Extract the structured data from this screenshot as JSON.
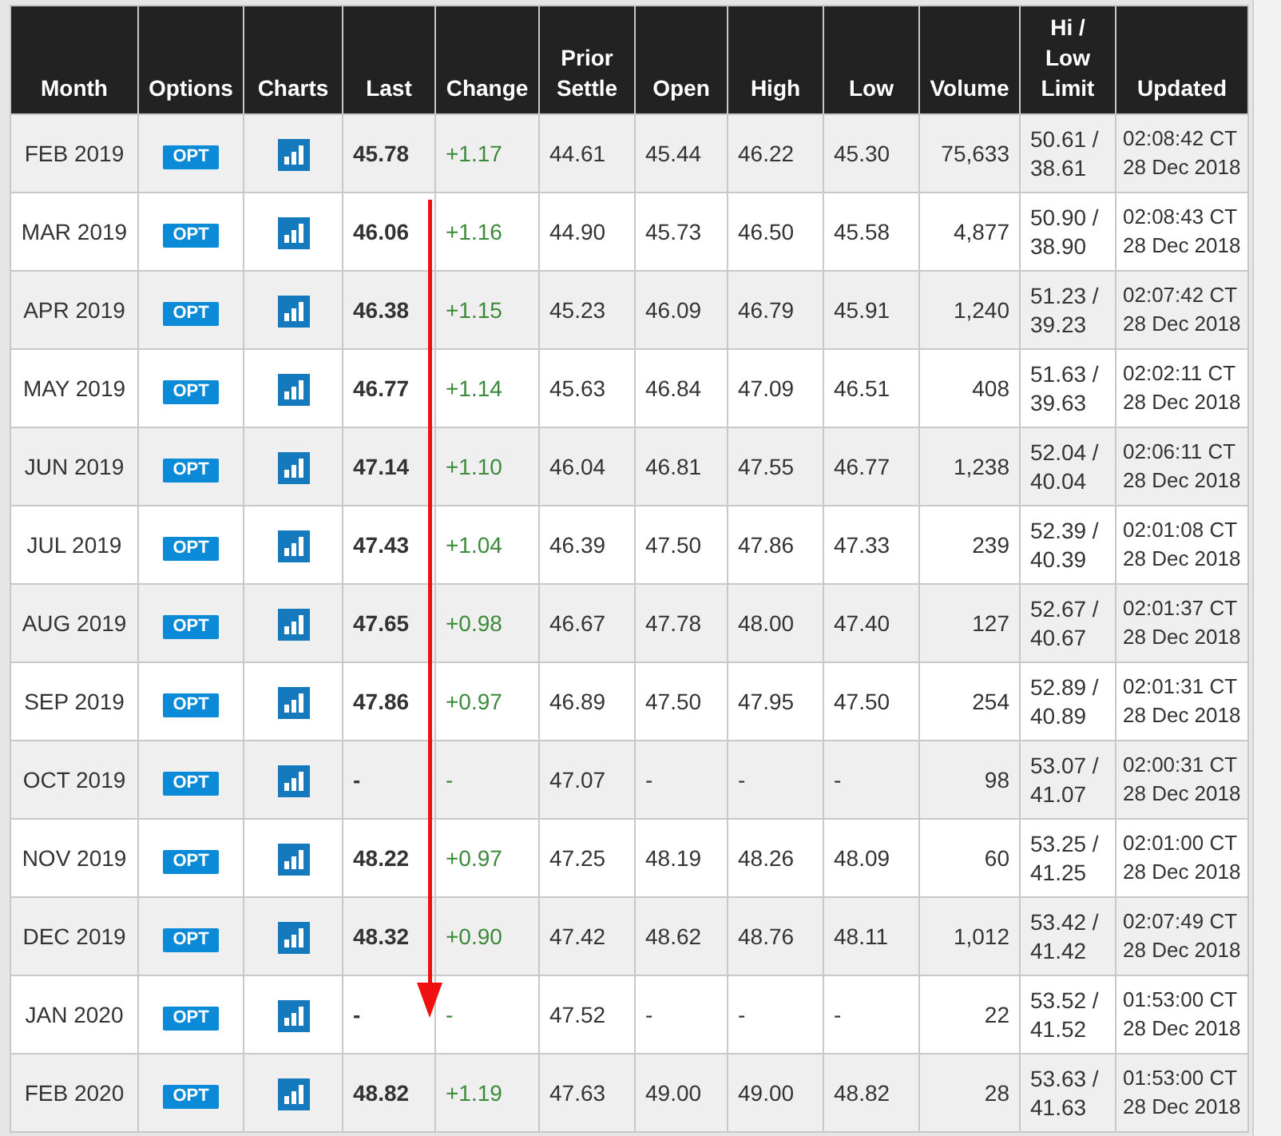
{
  "columns": [
    [
      "Month"
    ],
    [
      "Options"
    ],
    [
      "Charts"
    ],
    [
      "Last"
    ],
    [
      "Change"
    ],
    [
      "Prior",
      "Settle"
    ],
    [
      "Open"
    ],
    [
      "High"
    ],
    [
      "Low"
    ],
    [
      "Volume"
    ],
    [
      "Hi /",
      "Low",
      "Limit"
    ],
    [
      "Updated"
    ]
  ],
  "rows": [
    {
      "month": "FEB 2019",
      "options": "OPT",
      "last": "45.78",
      "change": "+1.17",
      "prior_settle": "44.61",
      "open": "45.44",
      "high": "46.22",
      "low": "45.30",
      "volume": "75,633",
      "limit_hi": "50.61 /",
      "limit_low": "38.61",
      "updated_time": "02:08:42 CT",
      "updated_date": "28 Dec 2018"
    },
    {
      "month": "MAR 2019",
      "options": "OPT",
      "last": "46.06",
      "change": "+1.16",
      "prior_settle": "44.90",
      "open": "45.73",
      "high": "46.50",
      "low": "45.58",
      "volume": "4,877",
      "limit_hi": "50.90 /",
      "limit_low": "38.90",
      "updated_time": "02:08:43 CT",
      "updated_date": "28 Dec 2018"
    },
    {
      "month": "APR 2019",
      "options": "OPT",
      "last": "46.38",
      "change": "+1.15",
      "prior_settle": "45.23",
      "open": "46.09",
      "high": "46.79",
      "low": "45.91",
      "volume": "1,240",
      "limit_hi": "51.23 /",
      "limit_low": "39.23",
      "updated_time": "02:07:42 CT",
      "updated_date": "28 Dec 2018"
    },
    {
      "month": "MAY 2019",
      "options": "OPT",
      "last": "46.77",
      "change": "+1.14",
      "prior_settle": "45.63",
      "open": "46.84",
      "high": "47.09",
      "low": "46.51",
      "volume": "408",
      "limit_hi": "51.63 /",
      "limit_low": "39.63",
      "updated_time": "02:02:11 CT",
      "updated_date": "28 Dec 2018"
    },
    {
      "month": "JUN 2019",
      "options": "OPT",
      "last": "47.14",
      "change": "+1.10",
      "prior_settle": "46.04",
      "open": "46.81",
      "high": "47.55",
      "low": "46.77",
      "volume": "1,238",
      "limit_hi": "52.04 /",
      "limit_low": "40.04",
      "updated_time": "02:06:11 CT",
      "updated_date": "28 Dec 2018"
    },
    {
      "month": "JUL 2019",
      "options": "OPT",
      "last": "47.43",
      "change": "+1.04",
      "prior_settle": "46.39",
      "open": "47.50",
      "high": "47.86",
      "low": "47.33",
      "volume": "239",
      "limit_hi": "52.39 /",
      "limit_low": "40.39",
      "updated_time": "02:01:08 CT",
      "updated_date": "28 Dec 2018"
    },
    {
      "month": "AUG 2019",
      "options": "OPT",
      "last": "47.65",
      "change": "+0.98",
      "prior_settle": "46.67",
      "open": "47.78",
      "high": "48.00",
      "low": "47.40",
      "volume": "127",
      "limit_hi": "52.67 /",
      "limit_low": "40.67",
      "updated_time": "02:01:37 CT",
      "updated_date": "28 Dec 2018"
    },
    {
      "month": "SEP 2019",
      "options": "OPT",
      "last": "47.86",
      "change": "+0.97",
      "prior_settle": "46.89",
      "open": "47.50",
      "high": "47.95",
      "low": "47.50",
      "volume": "254",
      "limit_hi": "52.89 /",
      "limit_low": "40.89",
      "updated_time": "02:01:31 CT",
      "updated_date": "28 Dec 2018"
    },
    {
      "month": "OCT 2019",
      "options": "OPT",
      "last": "-",
      "change": "-",
      "prior_settle": "47.07",
      "open": "-",
      "high": "-",
      "low": "-",
      "volume": "98",
      "limit_hi": "53.07 /",
      "limit_low": "41.07",
      "updated_time": "02:00:31 CT",
      "updated_date": "28 Dec 2018"
    },
    {
      "month": "NOV 2019",
      "options": "OPT",
      "last": "48.22",
      "change": "+0.97",
      "prior_settle": "47.25",
      "open": "48.19",
      "high": "48.26",
      "low": "48.09",
      "volume": "60",
      "limit_hi": "53.25 /",
      "limit_low": "41.25",
      "updated_time": "02:01:00 CT",
      "updated_date": "28 Dec 2018"
    },
    {
      "month": "DEC 2019",
      "options": "OPT",
      "last": "48.32",
      "change": "+0.90",
      "prior_settle": "47.42",
      "open": "48.62",
      "high": "48.76",
      "low": "48.11",
      "volume": "1,012",
      "limit_hi": "53.42 /",
      "limit_low": "41.42",
      "updated_time": "02:07:49 CT",
      "updated_date": "28 Dec 2018"
    },
    {
      "month": "JAN 2020",
      "options": "OPT",
      "last": "-",
      "change": "-",
      "prior_settle": "47.52",
      "open": "-",
      "high": "-",
      "low": "-",
      "volume": "22",
      "limit_hi": "53.52 /",
      "limit_low": "41.52",
      "updated_time": "01:53:00 CT",
      "updated_date": "28 Dec 2018"
    },
    {
      "month": "FEB 2020",
      "options": "OPT",
      "last": "48.82",
      "change": "+1.19",
      "prior_settle": "47.63",
      "open": "49.00",
      "high": "49.00",
      "low": "48.82",
      "volume": "28",
      "limit_hi": "53.63 /",
      "limit_low": "41.63",
      "updated_time": "01:53:00 CT",
      "updated_date": "28 Dec 2018"
    }
  ]
}
